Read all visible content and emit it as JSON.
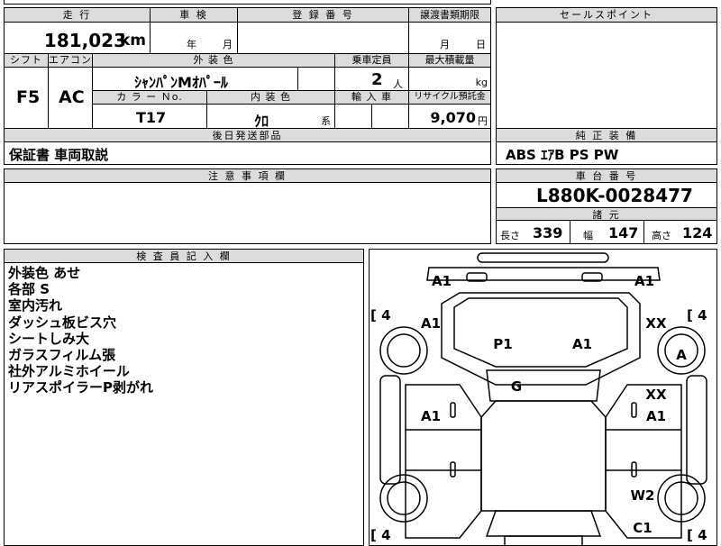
{
  "sheet": {
    "mileage": {
      "header": "走 行",
      "value": "181,023",
      "unit": "km"
    },
    "inspection": {
      "header": "車 検",
      "year": "年",
      "month": "月"
    },
    "registration": {
      "header": "登 録 番 号"
    },
    "transfer": {
      "header": "譲渡書類期限",
      "month": "月",
      "day": "日"
    },
    "shift": {
      "header": "シフト",
      "value": "F5"
    },
    "aircon": {
      "header": "エアコン",
      "value": "AC"
    },
    "exterior_color": {
      "header": "外 装 色",
      "value": "ｼｬﾝﾊﾟﾝMｵﾊﾟｰﾙ"
    },
    "capacity": {
      "header": "乗車定員",
      "value": "2",
      "unit": "人"
    },
    "max_load": {
      "header": "最大積載量",
      "unit": "kg"
    },
    "color_no": {
      "header": "カ ラ ー Ｎo.",
      "value": "T17"
    },
    "interior_color": {
      "header": "内 装 色",
      "value": "ｸﾛ",
      "suffix": "系"
    },
    "import": {
      "header": "輸 入 車"
    },
    "recycle": {
      "header": "リサイクル預託金",
      "value": "9,070",
      "unit": "円"
    },
    "sales_point": {
      "header": "セールスポイント"
    },
    "later_parts": {
      "header": "後日発送部品",
      "value": "保証書 車両取説"
    },
    "equipment": {
      "header": "純 正 装 備",
      "value": "ABS ｴｱB PS PW"
    },
    "caution": {
      "header": "注 意 事 項 欄"
    },
    "chassis": {
      "header": "車 台 番 号",
      "value": "L880K-0028477"
    },
    "specs": {
      "header": "諸 元",
      "length_label": "長さ",
      "length": "339",
      "width_label": "幅",
      "width": "147",
      "height_label": "高さ",
      "height": "124"
    },
    "inspector": {
      "header": "検 査 員 記 入 欄",
      "notes": [
        "外装色 あせ",
        "各部 S",
        "室内汚れ",
        "ダッシュ板ビス穴",
        "シートしみ大",
        "ガラスフィルム張",
        "社外アルミホイール",
        "リアスポイラーP剥がれ"
      ]
    },
    "diagram": {
      "codes": {
        "front_left_corner": "A1",
        "front_right_corner": "A1",
        "left_fender": "A1",
        "right_fender": "XX",
        "hood_left": "P1",
        "hood_right": "A1",
        "windshield": "G",
        "right_door_upper": "XX",
        "right_door": "A1",
        "left_door": "A1",
        "right_wheel": "A",
        "rear_right": "W2",
        "rear_bottom": "C1"
      },
      "tire_bracket_values": [
        "[ 4",
        "[ 4",
        "[ 4",
        "[ 4"
      ]
    }
  }
}
